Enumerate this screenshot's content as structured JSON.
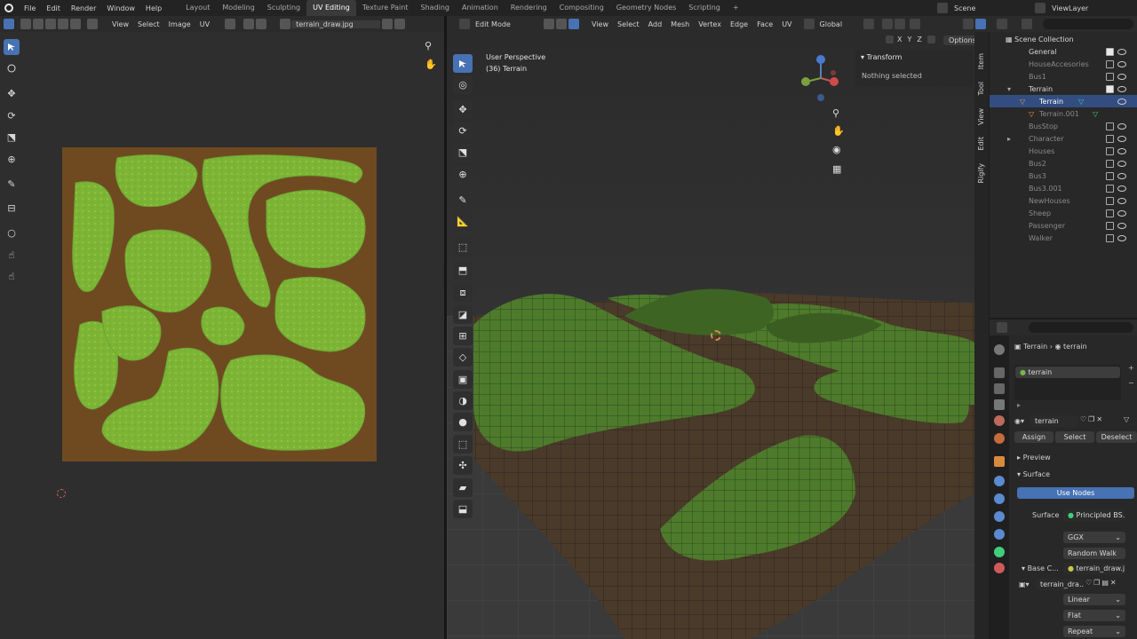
{
  "menu": {
    "items": [
      "File",
      "Edit",
      "Render",
      "Window",
      "Help"
    ],
    "workspaces": [
      "Layout",
      "Modeling",
      "Sculpting",
      "UV Editing",
      "Texture Paint",
      "Shading",
      "Animation",
      "Rendering",
      "Compositing",
      "Geometry Nodes",
      "Scripting"
    ],
    "active_workspace": "UV Editing",
    "add_tab": "+",
    "scene": "Scene",
    "view_layer": "ViewLayer"
  },
  "uv_header": {
    "menus": [
      "View",
      "Select",
      "Image",
      "UV"
    ],
    "image_name": "terrain_draw.jpg"
  },
  "viewport_header": {
    "mode": "Edit Mode",
    "menus": [
      "View",
      "Select",
      "Add",
      "Mesh",
      "Vertex",
      "Edge",
      "Face",
      "UV"
    ],
    "orientation": "Global",
    "axes": [
      "X",
      "Y",
      "Z"
    ],
    "options": "Options"
  },
  "viewport": {
    "perspective": "User Perspective",
    "object_info": "(36) Terrain",
    "panel_title": "Transform",
    "panel_text": "Nothing selected",
    "side_tabs": [
      "Item",
      "Tool",
      "View",
      "Edit",
      "Rigify"
    ]
  },
  "outliner": {
    "root": "Scene Collection",
    "items": [
      {
        "name": "General",
        "dim": false
      },
      {
        "name": "HouseAccesories",
        "dim": true
      },
      {
        "name": "Bus1",
        "dim": true
      },
      {
        "name": "Terrain",
        "dim": false
      },
      {
        "name": "Terrain",
        "dim": false,
        "selected": true
      },
      {
        "name": "Terrain.001",
        "dim": true
      },
      {
        "name": "BusStop",
        "dim": true
      },
      {
        "name": "Character",
        "dim": true
      },
      {
        "name": "Houses",
        "dim": true
      },
      {
        "name": "Bus2",
        "dim": true
      },
      {
        "name": "Bus3",
        "dim": true
      },
      {
        "name": "Bus3.001",
        "dim": true
      },
      {
        "name": "NewHouses",
        "dim": true
      },
      {
        "name": "Sheep",
        "dim": true
      },
      {
        "name": "Passenger",
        "dim": true
      },
      {
        "name": "Walker",
        "dim": true
      }
    ]
  },
  "properties": {
    "breadcrumb_object": "Terrain",
    "breadcrumb_material": "terrain",
    "slot_material": "terrain",
    "material_name": "terrain",
    "assign": "Assign",
    "select": "Select",
    "deselect": "Deselect",
    "preview": "Preview",
    "surface_section": "Surface",
    "use_nodes": "Use Nodes",
    "surface_label": "Surface",
    "surface_value": "Principled BS...",
    "distribution": "GGX",
    "subsurface": "Random Walk",
    "base_color_label": "Base C...",
    "base_color_value": "terrain_draw.j...",
    "image_block": "terrain_dra...",
    "interpolation": "Linear",
    "projection": "Flat",
    "extension": "Repeat"
  }
}
